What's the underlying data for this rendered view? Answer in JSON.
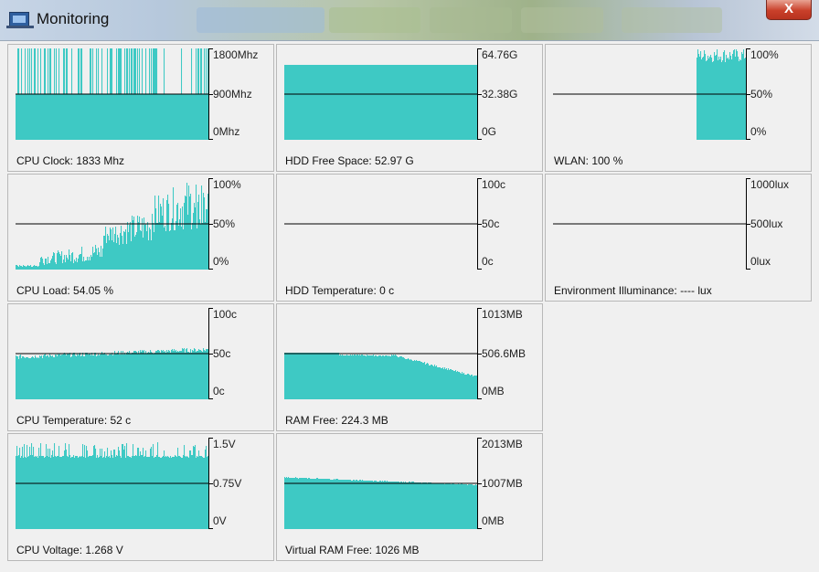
{
  "window": {
    "title": "Monitoring",
    "close_label": "X"
  },
  "colors": {
    "fill": "#3ec9c4",
    "axis": "#000000",
    "panel_bg": "#f0f0f0"
  },
  "panels": [
    {
      "caption": "CPU Clock: 1833 Mhz",
      "ticks": [
        "1800Mhz",
        "900Mhz",
        "0Mhz"
      ],
      "chart_data": {
        "type": "area",
        "ylabel": "",
        "ylim": [
          0,
          1800
        ],
        "pattern": "clock",
        "level": 1,
        "spike_level": 1800,
        "base_level": 900
      }
    },
    {
      "caption": "HDD Free Space: 52.97 G",
      "ticks": [
        "64.76G",
        "32.38G",
        "0G"
      ],
      "chart_data": {
        "type": "area",
        "ylim": [
          0,
          64.76
        ],
        "pattern": "flat",
        "value": 52.97
      }
    },
    {
      "caption": "WLAN: 100 %",
      "ticks": [
        "100%",
        "50%",
        "0%"
      ],
      "chart_data": {
        "type": "area",
        "ylim": [
          0,
          100
        ],
        "pattern": "wlan",
        "value": 100
      }
    },
    {
      "caption": "CPU Load: 54.05 %",
      "ticks": [
        "100%",
        "50%",
        "0%"
      ],
      "chart_data": {
        "type": "area",
        "ylim": [
          0,
          100
        ],
        "pattern": "load",
        "value": 54.05
      }
    },
    {
      "caption": "HDD Temperature: 0 c",
      "ticks": [
        "100c",
        "50c",
        "0c"
      ],
      "chart_data": {
        "type": "area",
        "ylim": [
          0,
          100
        ],
        "pattern": "none",
        "value": 0
      }
    },
    {
      "caption": "Environment Illuminance: ---- lux",
      "ticks": [
        "1000lux",
        "500lux",
        "0lux"
      ],
      "chart_data": {
        "type": "area",
        "ylim": [
          0,
          1000
        ],
        "pattern": "none",
        "value": null
      }
    },
    {
      "caption": "CPU Temperature: 52 c",
      "ticks": [
        "100c",
        "50c",
        "0c"
      ],
      "chart_data": {
        "type": "area",
        "ylim": [
          0,
          100
        ],
        "pattern": "temp",
        "value": 52
      }
    },
    {
      "caption": "RAM Free: 224.3 MB",
      "ticks": [
        "1013MB",
        "506.6MB",
        "0MB"
      ],
      "chart_data": {
        "type": "area",
        "ylim": [
          0,
          1013
        ],
        "pattern": "ram",
        "value": 224.3
      }
    },
    null,
    {
      "caption": "CPU Voltage: 1.268 V",
      "ticks": [
        "1.5V",
        "0.75V",
        "0V"
      ],
      "chart_data": {
        "type": "area",
        "ylim": [
          0,
          1.5
        ],
        "pattern": "volt",
        "value": 1.268
      }
    },
    {
      "caption": "Virtual RAM Free: 1026 MB",
      "ticks": [
        "2013MB",
        "1007MB",
        "0MB"
      ],
      "chart_data": {
        "type": "area",
        "ylim": [
          0,
          2013
        ],
        "pattern": "vram",
        "value": 1026
      }
    },
    null
  ]
}
